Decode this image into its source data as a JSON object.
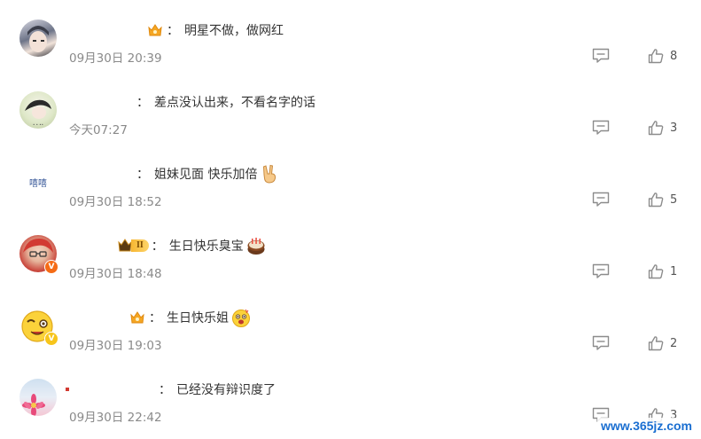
{
  "comments": [
    {
      "text": "明星不做，做网红",
      "time": "09月30日 20:39",
      "likes": "8"
    },
    {
      "text": "差点没认出来，不看名字的话",
      "time": "今天07:27",
      "likes": "3",
      "avatar_text": "• • ••"
    },
    {
      "text": "姐妹见面 快乐加倍",
      "time": "09月30日 18:52",
      "likes": "5",
      "avatar_text": "嘻嘻"
    },
    {
      "text": "生日快乐臭宝",
      "time": "09月30日 18:48",
      "likes": "1",
      "level_badge": "II",
      "verified_mark": "V"
    },
    {
      "text": "生日快乐姐",
      "time": "09月30日 19:03",
      "likes": "2",
      "verified_mark": "V"
    },
    {
      "text": "已经没有辩识度了",
      "time": "09月30日 22:42",
      "likes": "3"
    }
  ],
  "colon": "：",
  "watermark": "www.365jz.com",
  "icons": {
    "reply": "comment-bubble-icon",
    "like": "thumbs-up-icon"
  },
  "colors": {
    "text": "#333333",
    "time": "#8a8a8a",
    "icon": "#8c8c8c",
    "verified_orange": "#f56b16",
    "verified_yellow": "#f7c51b",
    "watermark": "#1b6fd1"
  }
}
